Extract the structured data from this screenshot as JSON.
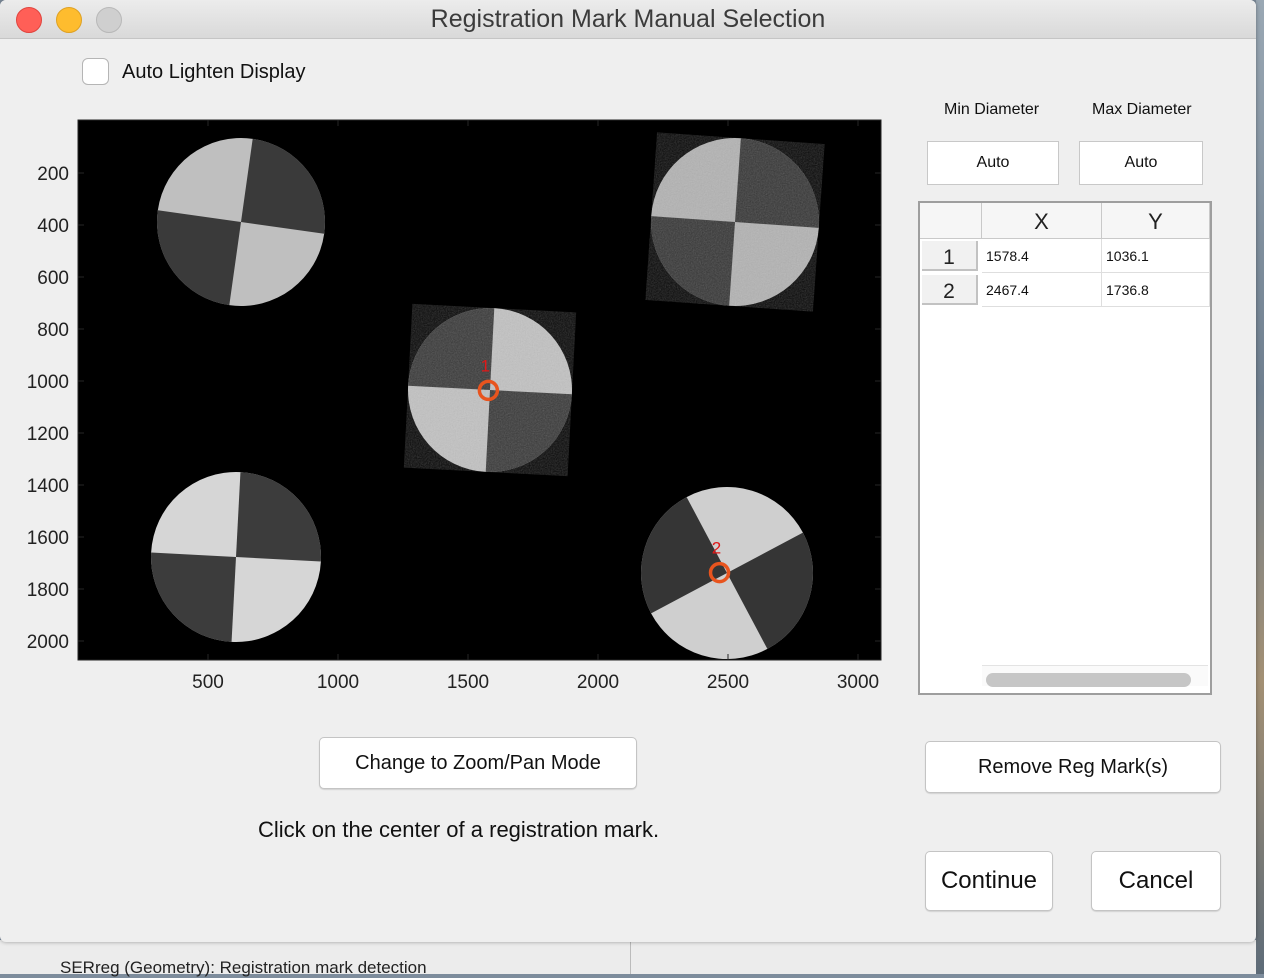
{
  "window": {
    "title": "Registration Mark Manual Selection"
  },
  "options": {
    "auto_lighten_label": "Auto Lighten Display",
    "auto_lighten_checked": false
  },
  "plot": {
    "x_ticks": [
      "500",
      "1000",
      "1500",
      "2000",
      "2500",
      "3000"
    ],
    "y_ticks": [
      "200",
      "400",
      "600",
      "800",
      "1000",
      "1200",
      "1400",
      "1600",
      "1800",
      "2000"
    ],
    "markers": [
      {
        "label": "1",
        "x": 1578.4,
        "y": 1036.1
      },
      {
        "label": "2",
        "x": 2467.4,
        "y": 1736.8
      }
    ],
    "marker_color": "#e8541e",
    "marker_label_color": "#e01818"
  },
  "diameter": {
    "min_label": "Min Diameter",
    "max_label": "Max Diameter",
    "min_value": "Auto",
    "max_value": "Auto"
  },
  "table": {
    "columns": [
      "X",
      "Y"
    ],
    "rows": [
      {
        "index": "1",
        "x": "1578.4",
        "y": "1036.1"
      },
      {
        "index": "2",
        "x": "2467.4",
        "y": "1736.8"
      }
    ]
  },
  "buttons": {
    "zoom_pan": "Change to Zoom/Pan Mode",
    "remove": "Remove Reg Mark(s)",
    "continue": "Continue",
    "cancel": "Cancel"
  },
  "instruction": "Click on the center of a registration mark.",
  "background_window": {
    "status_text": "SERreg (Geometry): Registration mark detection"
  }
}
